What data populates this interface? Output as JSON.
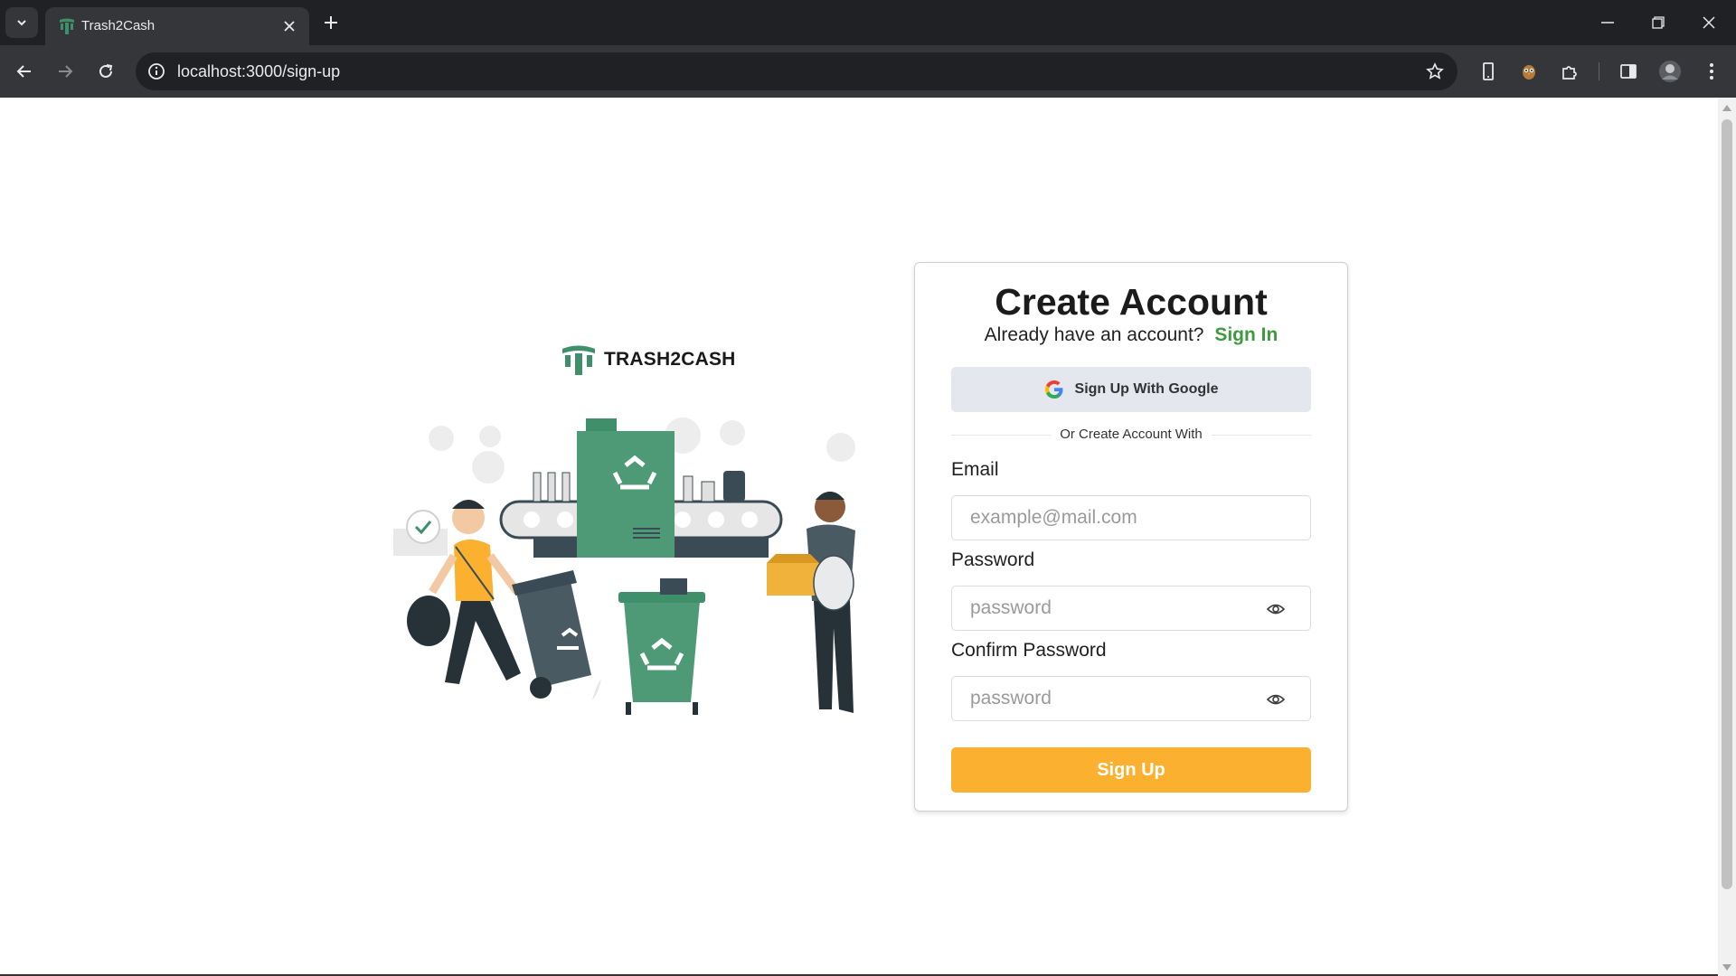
{
  "browser": {
    "tab": {
      "title": "Trash2Cash"
    },
    "address_bar": {
      "url": "localhost:3000/sign-up"
    },
    "icons": [
      "tab-list-icon",
      "close-icon",
      "plus-icon",
      "minimize-icon",
      "restore-icon",
      "back-arrow-icon",
      "forward-arrow-icon",
      "reload-icon",
      "info-icon",
      "star-icon",
      "extension-icon",
      "puzzle-icon",
      "sidepanel-icon",
      "profile-avatar",
      "kebab-menu-icon"
    ]
  },
  "brand": {
    "name": "TRASH2CASH",
    "color": "#3f8f6a"
  },
  "signup": {
    "title": "Create Account",
    "subtitle": "Already have an account?",
    "signin_link": "Sign In",
    "google_button": "Sign Up With Google",
    "divider_text": "Or Create Account With",
    "email": {
      "label": "Email",
      "placeholder": "example@mail.com"
    },
    "password": {
      "label": "Password",
      "placeholder": "password"
    },
    "confirm_password": {
      "label": "Confirm Password",
      "placeholder": "password"
    },
    "submit": "Sign Up"
  },
  "colors": {
    "accent_green": "#3d9a3d",
    "button_yellow": "#fbb12f",
    "google_button_bg": "#e4e7ee"
  }
}
